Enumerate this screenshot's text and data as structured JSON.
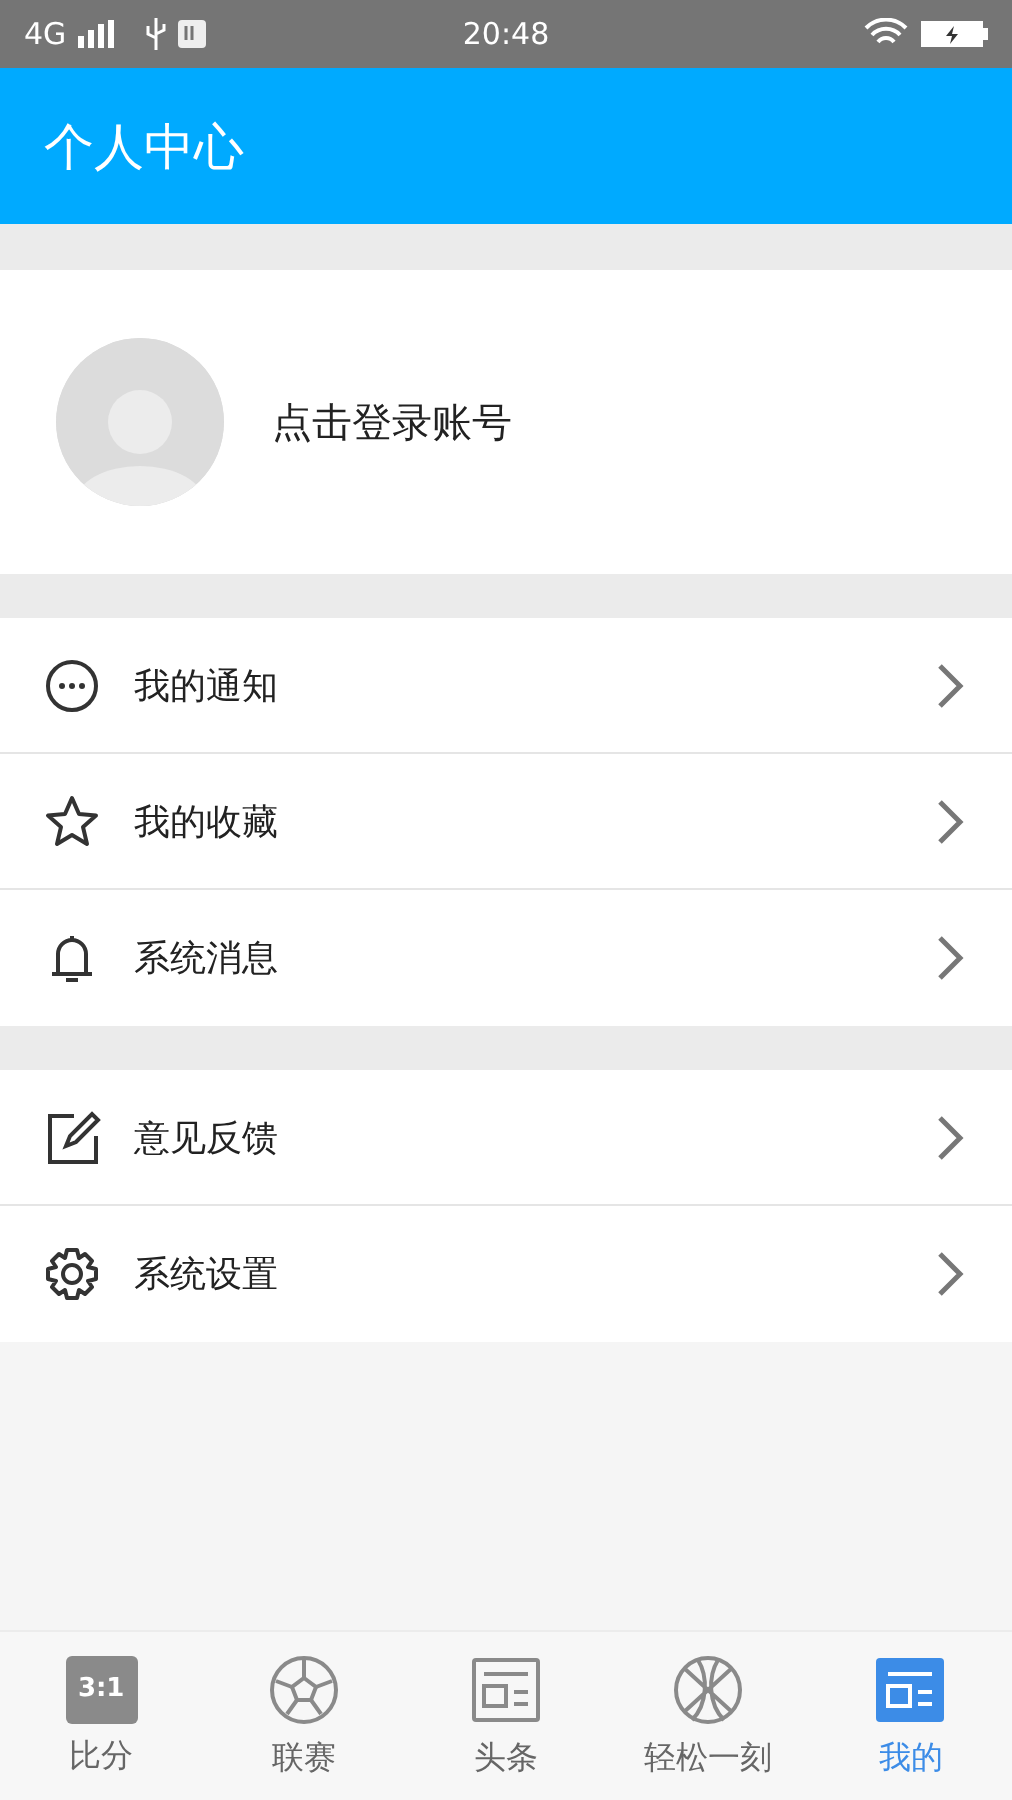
{
  "status_bar": {
    "network": "4G",
    "time": "20:48"
  },
  "header": {
    "title": "个人中心"
  },
  "profile": {
    "login_text": "点击登录账号"
  },
  "menu_groups": [
    {
      "items": [
        {
          "kind": "notice",
          "label": "我的通知"
        },
        {
          "kind": "star",
          "label": "我的收藏"
        },
        {
          "kind": "bell",
          "label": "系统消息"
        }
      ]
    },
    {
      "items": [
        {
          "kind": "edit",
          "label": "意见反馈"
        },
        {
          "kind": "gear",
          "label": "系统设置"
        }
      ]
    }
  ],
  "bottom_nav": [
    {
      "kind": "calendar",
      "icon_text": "3:1",
      "label": "比分",
      "selected": false
    },
    {
      "kind": "ball",
      "label": "联赛",
      "selected": false
    },
    {
      "kind": "news",
      "label": "头条",
      "selected": false
    },
    {
      "kind": "basketball",
      "label": "轻松一刻",
      "selected": false
    },
    {
      "kind": "news",
      "label": "我的",
      "selected": true
    }
  ]
}
